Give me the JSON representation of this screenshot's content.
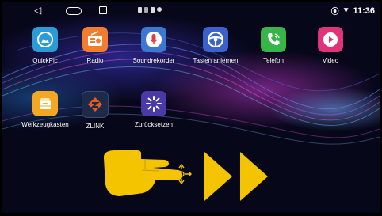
{
  "statusbar": {
    "time": "11:36",
    "nav_back_glyph": "◁",
    "icons": [
      "back-icon",
      "home-icon",
      "recent-apps-icon",
      "location-icon",
      "wifi-icon"
    ]
  },
  "apps": [
    {
      "label": "QuickPic",
      "icon": "gallery-icon",
      "color": "#2b9ad8"
    },
    {
      "label": "Radio",
      "icon": "radio-icon",
      "color": "#f07e2e"
    },
    {
      "label": "Soundrekorder",
      "icon": "microphone-icon",
      "color": "#3d78d0"
    },
    {
      "label": "Tasten anlernen",
      "icon": "steering-wheel-icon",
      "color": "#3a62c9"
    },
    {
      "label": "Telefon",
      "icon": "phone-icon",
      "color": "#37b54a"
    },
    {
      "label": "Video",
      "icon": "play-icon",
      "color": "#e0347a"
    },
    {
      "label": "Werkzeugkasten",
      "icon": "toolbox-icon",
      "color": "#f5a623"
    },
    {
      "label": "ZLINK",
      "icon": "zlink-icon",
      "color": "#e85a1b"
    },
    {
      "label": "Zurücksetzen",
      "icon": "reset-icon",
      "color": "#4a3aa8"
    }
  ],
  "gesture_hint": {
    "icon": "swipe-hand-icon",
    "arrows": "double-arrow-right-icon",
    "color": "#f5c400"
  }
}
